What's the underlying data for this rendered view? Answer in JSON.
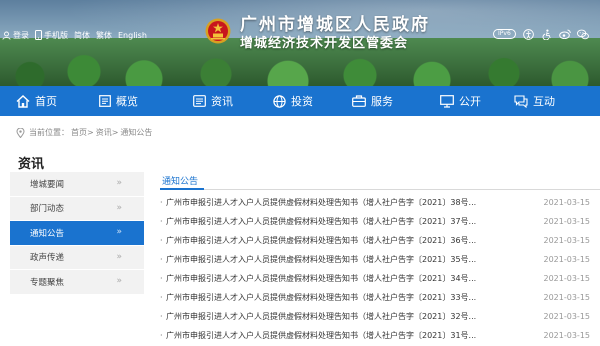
{
  "header": {
    "top_links": [
      {
        "icon": "user-icon",
        "label": "登录"
      },
      {
        "icon": "mobile-icon",
        "label": "手机版"
      },
      {
        "icon": "",
        "label": "简体"
      },
      {
        "icon": "",
        "label": "繁体"
      },
      {
        "icon": "",
        "label": "English"
      }
    ],
    "title_line1": "广州市增城区人民政府",
    "title_line2": "增城经济技术开发区管委会",
    "ipv6": "IPv6",
    "access_icons": [
      "wheelchair-icon",
      "accessibility-icon",
      "weibo-icon",
      "wechat-icon"
    ]
  },
  "nav": {
    "items": [
      {
        "label": "首页",
        "icon": "home-icon"
      },
      {
        "label": "概览",
        "icon": "overview-icon"
      },
      {
        "label": "资讯",
        "icon": "news-icon"
      },
      {
        "label": "投资",
        "icon": "globe-icon"
      },
      {
        "label": "服务",
        "icon": "briefcase-icon"
      },
      {
        "label": "公开",
        "icon": "monitor-icon"
      },
      {
        "label": "互动",
        "icon": "chat-icon"
      }
    ]
  },
  "breadcrumb": {
    "prefix": "当前位置：",
    "items": [
      "首页",
      "资讯",
      "通知公告"
    ],
    "separator": ">"
  },
  "sidebar": {
    "title": "资讯",
    "items": [
      {
        "label": "增城要闻",
        "active": false
      },
      {
        "label": "部门动态",
        "active": false
      },
      {
        "label": "通知公告",
        "active": true
      },
      {
        "label": "政声传递",
        "active": false
      },
      {
        "label": "专题聚焦",
        "active": false
      }
    ],
    "chevron": "»"
  },
  "main": {
    "section_title": "通知公告",
    "bullet": "·",
    "list": [
      {
        "title": "广州市申报引进人才入户人员提供虚假材料处理告知书（增人社户告字〔2021〕38号...",
        "date": "2021-03-15"
      },
      {
        "title": "广州市申报引进人才入户人员提供虚假材料处理告知书（增人社户告字〔2021〕37号...",
        "date": "2021-03-15"
      },
      {
        "title": "广州市申报引进人才入户人员提供虚假材料处理告知书（增人社户告字〔2021〕36号...",
        "date": "2021-03-15"
      },
      {
        "title": "广州市申报引进人才入户人员提供虚假材料处理告知书（增人社户告字〔2021〕35号...",
        "date": "2021-03-15"
      },
      {
        "title": "广州市申报引进人才入户人员提供虚假材料处理告知书（增人社户告字〔2021〕34号...",
        "date": "2021-03-15"
      },
      {
        "title": "广州市申报引进人才入户人员提供虚假材料处理告知书（增人社户告字〔2021〕33号...",
        "date": "2021-03-15"
      },
      {
        "title": "广州市申报引进人才入户人员提供虚假材料处理告知书（增人社户告字〔2021〕32号...",
        "date": "2021-03-15"
      },
      {
        "title": "广州市申报引进人才入户人员提供虚假材料处理告知书（增人社户告字〔2021〕31号...",
        "date": "2021-03-15"
      }
    ]
  },
  "colors": {
    "brand_blue": "#1a73cf",
    "active_nav": "#0f60b6",
    "sidebar_bg": "#f2f2f2"
  }
}
